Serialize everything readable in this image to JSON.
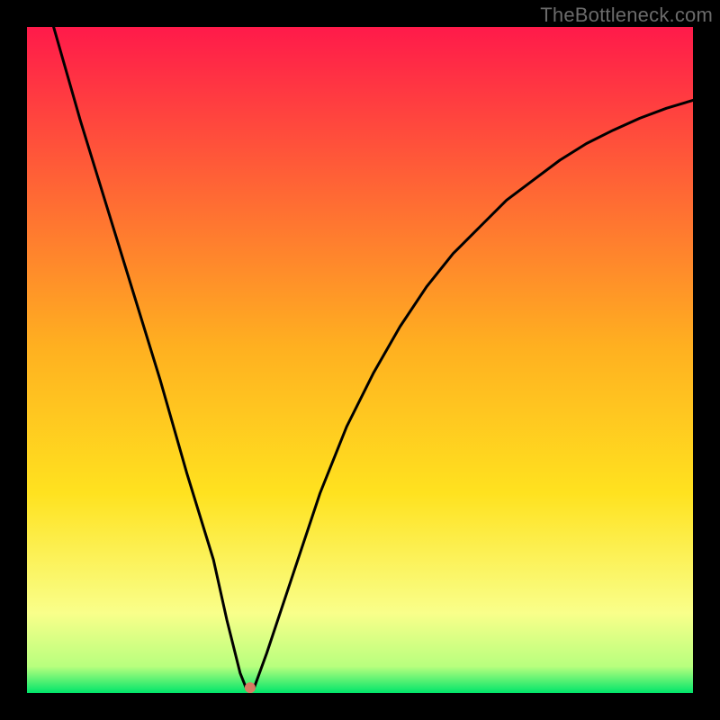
{
  "watermark": "TheBottleneck.com",
  "colors": {
    "bg": "#000000",
    "grad_top": "#ff1a4a",
    "grad_mid": "#ffd21f",
    "grad_low": "#f9ff8a",
    "grad_bottom": "#00e56a",
    "curve": "#000000",
    "marker": "#d77b62"
  },
  "chart_data": {
    "type": "line",
    "title": "",
    "xlabel": "",
    "ylabel": "",
    "xlim": [
      0,
      100
    ],
    "ylim": [
      0,
      100
    ],
    "grid": false,
    "legend": false,
    "series": [
      {
        "name": "curve",
        "x": [
          4,
          8,
          12,
          16,
          20,
          24,
          28,
          30,
          32,
          33,
          34,
          36,
          40,
          44,
          48,
          52,
          56,
          60,
          64,
          68,
          72,
          76,
          80,
          84,
          88,
          92,
          96,
          100
        ],
        "values": [
          100,
          86,
          73,
          60,
          47,
          33,
          20,
          11,
          3,
          0.5,
          0.5,
          6,
          18,
          30,
          40,
          48,
          55,
          61,
          66,
          70,
          74,
          77,
          80,
          82.5,
          84.5,
          86.3,
          87.8,
          89
        ]
      }
    ],
    "marker": {
      "x": 33.5,
      "y": 0.8
    }
  }
}
